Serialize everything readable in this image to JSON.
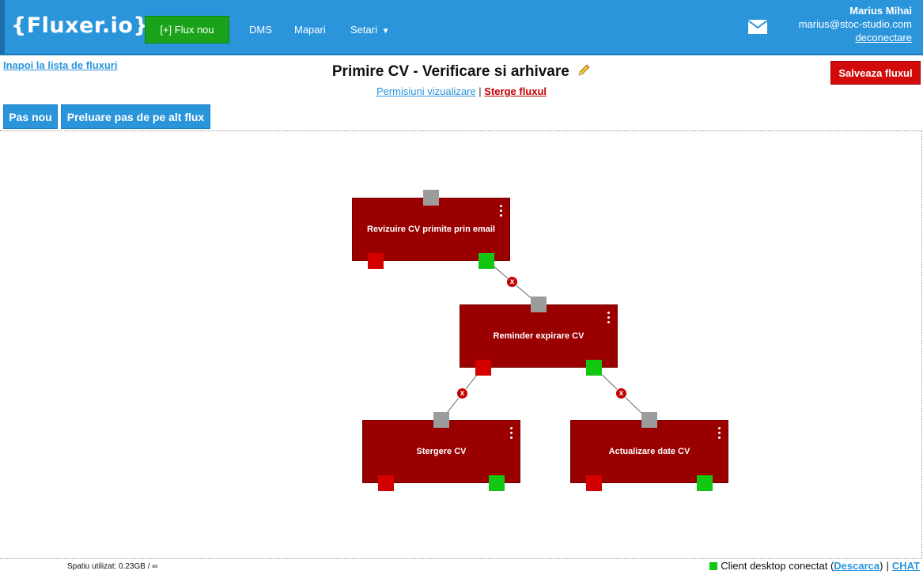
{
  "header": {
    "logo": "{Fluxer.io}",
    "new_flux_button": "[+] Flux nou",
    "nav": {
      "dms": "DMS",
      "mapari": "Mapari",
      "setari": "Setari",
      "setari_caret": "▼"
    },
    "user": {
      "name": "Marius Mihai",
      "email": "marius@stoc-studio.com",
      "logout": "deconectare"
    },
    "mail_icon": "envelope-icon"
  },
  "subheader": {
    "back_link": "Inapoi la lista de fluxuri",
    "title": "Primire CV - Verificare si arhivare",
    "permissions_link": "Permisiuni vizualizare",
    "separator": "|",
    "delete_link": "Sterge fluxul",
    "save_button": "Salveaza fluxul"
  },
  "toolbar": {
    "new_step": "Pas nou",
    "import_step": "Preluare pas de pe alt flux"
  },
  "flow": {
    "nodes": [
      {
        "label": "Revizuire CV primite prin email"
      },
      {
        "label": "Reminder expirare CV"
      },
      {
        "label": "Stergere CV"
      },
      {
        "label": "Actualizare date CV"
      }
    ],
    "remove_symbol": "x",
    "colors": {
      "node": "#9b0000",
      "port_in": "#9c9c9c",
      "port_fail": "#d40000",
      "port_ok": "#12c712",
      "accent": "#2b95dc"
    }
  },
  "footer": {
    "space_used": "Spatiu utilizat: 0.23GB / ∞",
    "client_status": "Client desktop conectat (",
    "download_link": "Descarca",
    "close_paren": ")",
    "separator": "|",
    "chat_link": "CHAT"
  }
}
